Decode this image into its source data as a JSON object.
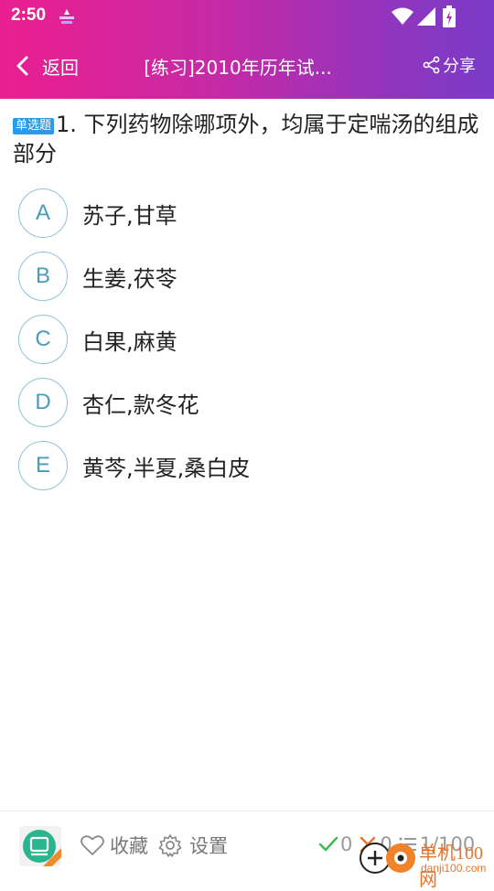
{
  "status_bar": {
    "time": "2:50"
  },
  "nav": {
    "back_label": "返回",
    "title": "[练习]2010年历年试...",
    "share_label": "分享"
  },
  "question": {
    "type_badge": "单选题",
    "text": "1. 下列药物除哪项外，均属于定喘汤的组成部分"
  },
  "options": [
    {
      "letter": "A",
      "text": "苏子,甘草"
    },
    {
      "letter": "B",
      "text": "生姜,茯苓"
    },
    {
      "letter": "C",
      "text": "白果,麻黄"
    },
    {
      "letter": "D",
      "text": "杏仁,款冬花"
    },
    {
      "letter": "E",
      "text": "黄芩,半夏,桑白皮"
    }
  ],
  "bottom_bar": {
    "favorite_label": "收藏",
    "settings_label": "设置",
    "correct_count": "0",
    "wrong_count": "0",
    "progress": "1/100"
  },
  "watermark": {
    "brand": "单机100网",
    "url": "danji100.com"
  },
  "colors": {
    "header_start": "#ea1f8f",
    "header_end": "#7a3bc6",
    "badge": "#2a9be6",
    "option_ring": "#8ec3d6",
    "option_letter": "#4a9cbc",
    "correct": "#3cba54",
    "wrong": "#e8742a"
  }
}
